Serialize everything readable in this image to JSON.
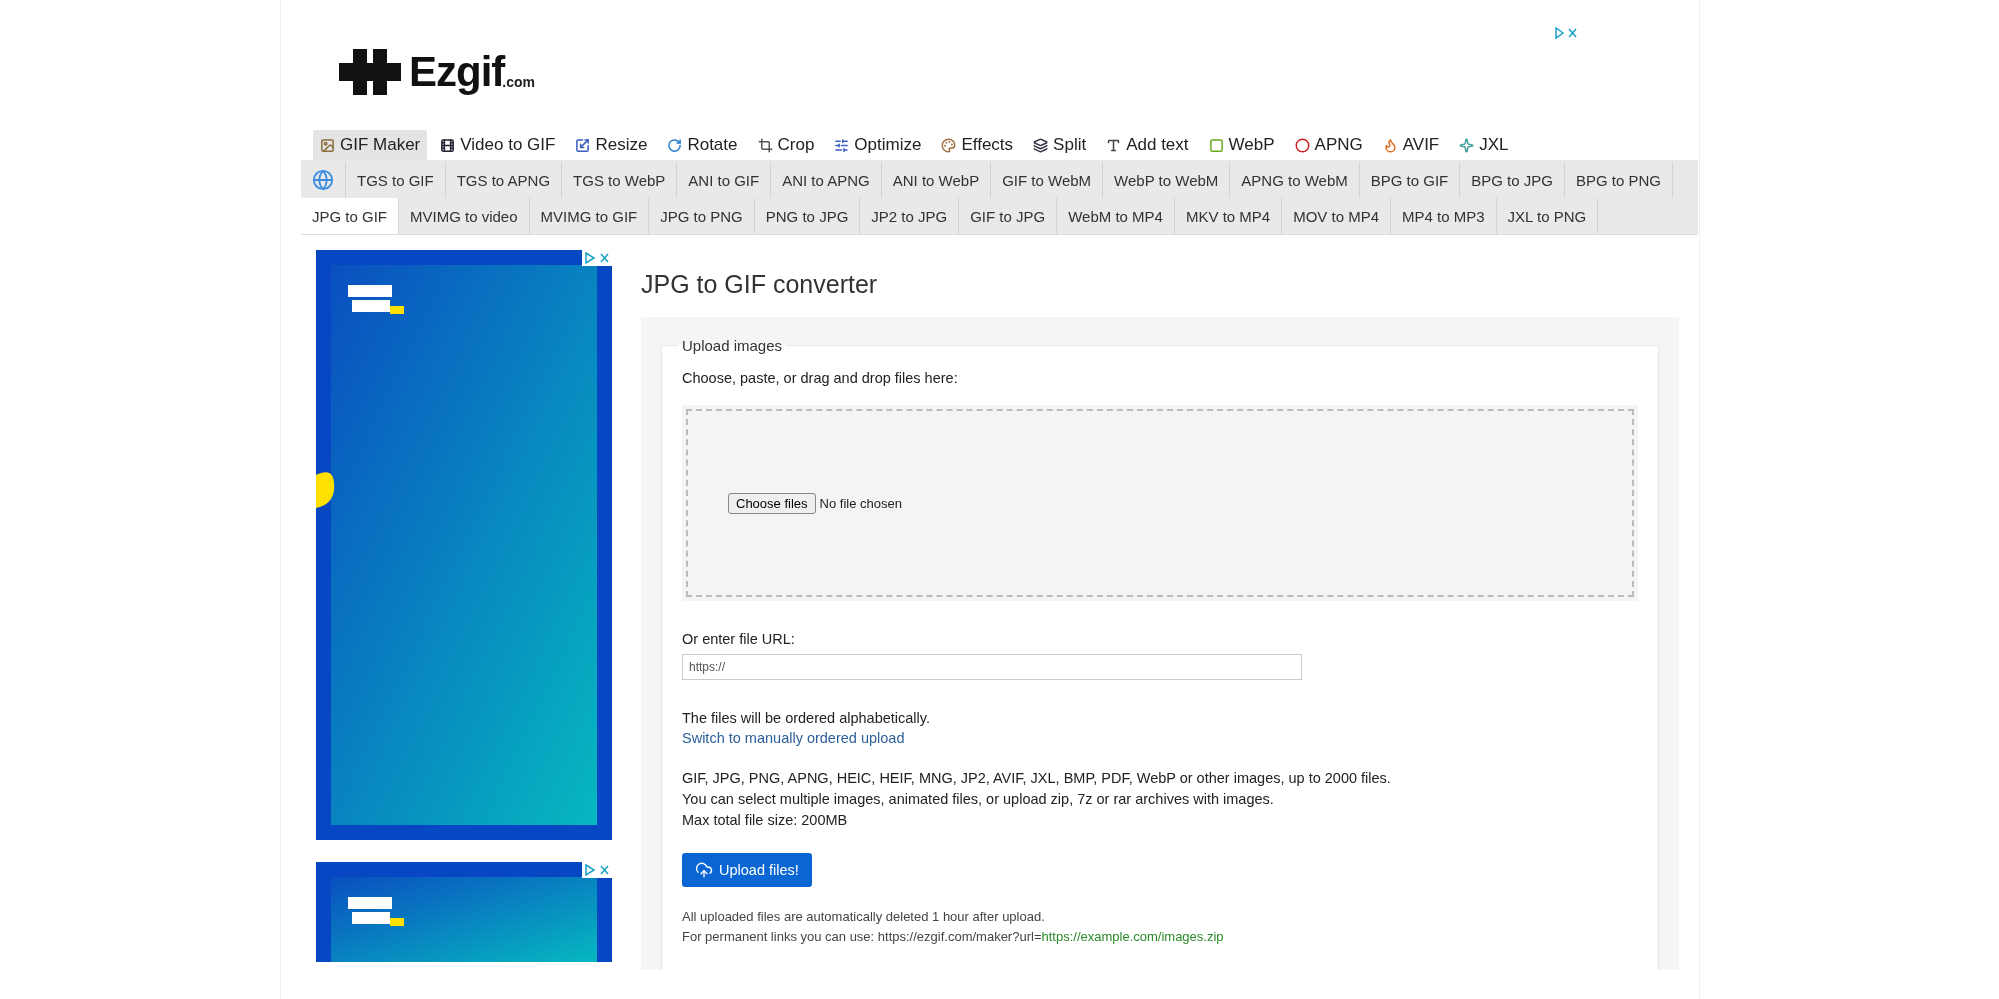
{
  "logo": {
    "name": "Ezgif",
    "suffix": ".com"
  },
  "main_nav": [
    {
      "label": "GIF Maker",
      "selected": true
    },
    {
      "label": "Video to GIF",
      "selected": false
    },
    {
      "label": "Resize",
      "selected": false
    },
    {
      "label": "Rotate",
      "selected": false
    },
    {
      "label": "Crop",
      "selected": false
    },
    {
      "label": "Optimize",
      "selected": false
    },
    {
      "label": "Effects",
      "selected": false
    },
    {
      "label": "Split",
      "selected": false
    },
    {
      "label": "Add text",
      "selected": false
    },
    {
      "label": "WebP",
      "selected": false
    },
    {
      "label": "APNG",
      "selected": false
    },
    {
      "label": "AVIF",
      "selected": false
    },
    {
      "label": "JXL",
      "selected": false
    }
  ],
  "sub_nav": [
    {
      "label": "TGS to GIF",
      "selected": false
    },
    {
      "label": "TGS to APNG",
      "selected": false
    },
    {
      "label": "TGS to WebP",
      "selected": false
    },
    {
      "label": "ANI to GIF",
      "selected": false
    },
    {
      "label": "ANI to APNG",
      "selected": false
    },
    {
      "label": "ANI to WebP",
      "selected": false
    },
    {
      "label": "GIF to WebM",
      "selected": false
    },
    {
      "label": "WebP to WebM",
      "selected": false
    },
    {
      "label": "APNG to WebM",
      "selected": false
    },
    {
      "label": "BPG to GIF",
      "selected": false
    },
    {
      "label": "BPG to JPG",
      "selected": false
    },
    {
      "label": "BPG to PNG",
      "selected": false
    },
    {
      "label": "JPG to GIF",
      "selected": true
    },
    {
      "label": "MVIMG to video",
      "selected": false
    },
    {
      "label": "MVIMG to GIF",
      "selected": false
    },
    {
      "label": "JPG to PNG",
      "selected": false
    },
    {
      "label": "PNG to JPG",
      "selected": false
    },
    {
      "label": "JP2 to JPG",
      "selected": false
    },
    {
      "label": "GIF to JPG",
      "selected": false
    },
    {
      "label": "WebM to MP4",
      "selected": false
    },
    {
      "label": "MKV to MP4",
      "selected": false
    },
    {
      "label": "MOV to MP4",
      "selected": false
    },
    {
      "label": "MP4 to MP3",
      "selected": false
    },
    {
      "label": "JXL to PNG",
      "selected": false
    }
  ],
  "title": "JPG to GIF converter",
  "upload": {
    "legend": "Upload images",
    "instruction": "Choose, paste, or drag and drop files here:",
    "file_input": {
      "button": "Choose files",
      "status": "No file chosen"
    },
    "url_label": "Or enter file URL:",
    "url_field": {
      "placeholder": "https://"
    },
    "order_note": "The files will be ordered alphabetically.",
    "switch_link": "Switch to manually ordered upload",
    "info": [
      "GIF, JPG, PNG, APNG, HEIC, HEIF, MNG, JP2, AVIF, JXL, BMP, PDF, WebP or other images, up to 2000 files.",
      "You can select multiple images, animated files, or upload zip, 7z or rar archives with images.",
      "Max total file size: 200MB"
    ],
    "upload_button": "Upload files!",
    "notes": [
      "All uploaded files are automatically deleted 1 hour after upload."
    ],
    "permanent_note": {
      "text": "For permanent links you can use: https://ezgif.com/maker?url=",
      "example": "https://example.com/images.zip"
    }
  }
}
